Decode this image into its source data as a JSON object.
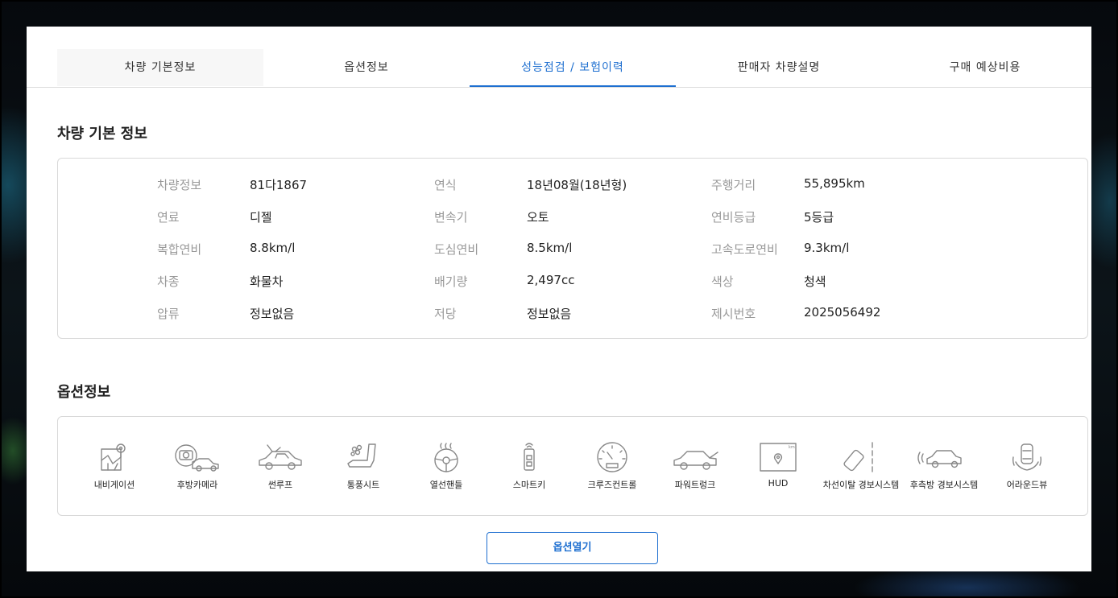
{
  "tabs": [
    "차량 기본정보",
    "옵션정보",
    "성능점검 / 보험이력",
    "판매자 차량설명",
    "구매 예상비용"
  ],
  "basic": {
    "title": "차량 기본 정보",
    "rows": [
      [
        [
          "차량정보",
          "81다1867"
        ],
        [
          "연식",
          "18년08월(18년형)"
        ],
        [
          "주행거리",
          "55,895km"
        ]
      ],
      [
        [
          "연료",
          "디젤"
        ],
        [
          "변속기",
          "오토"
        ],
        [
          "연비등급",
          "5등급"
        ]
      ],
      [
        [
          "복합연비",
          "8.8km/l"
        ],
        [
          "도심연비",
          "8.5km/l"
        ],
        [
          "고속도로연비",
          "9.3km/l"
        ]
      ],
      [
        [
          "차종",
          "화물차"
        ],
        [
          "배기량",
          "2,497cc"
        ],
        [
          "색상",
          "청색"
        ]
      ],
      [
        [
          "압류",
          "정보없음"
        ],
        [
          "저당",
          "정보없음"
        ],
        [
          "제시번호",
          "2025056492"
        ]
      ]
    ]
  },
  "options": {
    "title": "옵션정보",
    "items": [
      {
        "label": "내비게이션",
        "icon": "navigation-icon"
      },
      {
        "label": "후방카메라",
        "icon": "rear-camera-icon"
      },
      {
        "label": "썬루프",
        "icon": "sunroof-icon"
      },
      {
        "label": "통풍시트",
        "icon": "ventilated-seat-icon"
      },
      {
        "label": "열선핸들",
        "icon": "heated-steering-icon"
      },
      {
        "label": "스마트키",
        "icon": "smart-key-icon"
      },
      {
        "label": "크루즈컨트롤",
        "icon": "cruise-control-icon"
      },
      {
        "label": "파워트렁크",
        "icon": "power-trunk-icon"
      },
      {
        "label": "HUD",
        "icon": "hud-icon"
      },
      {
        "label": "차선이탈 경보시스템",
        "icon": "lane-departure-icon"
      },
      {
        "label": "후측방 경보시스템",
        "icon": "blind-spot-icon"
      },
      {
        "label": "어라운드뷰",
        "icon": "around-view-icon"
      }
    ],
    "open_label": "옵션열기"
  },
  "colors": {
    "accent": "#1e6fd0",
    "label": "#999999",
    "text": "#222222"
  }
}
